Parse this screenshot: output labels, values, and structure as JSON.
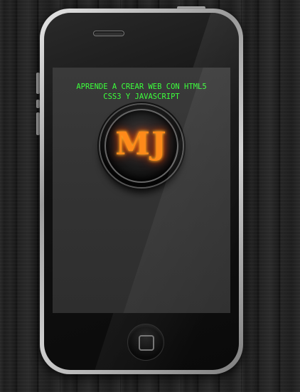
{
  "screen": {
    "headline_line1": "APRENDE A CREAR WEB CON HTML5",
    "headline_line2": "CSS3 Y JAVASCRIPT",
    "headline_color": "#3cff3c"
  },
  "logo": {
    "text": "MJ",
    "color": "#ff8a1a"
  },
  "icons": {
    "home": "home-square-icon"
  }
}
